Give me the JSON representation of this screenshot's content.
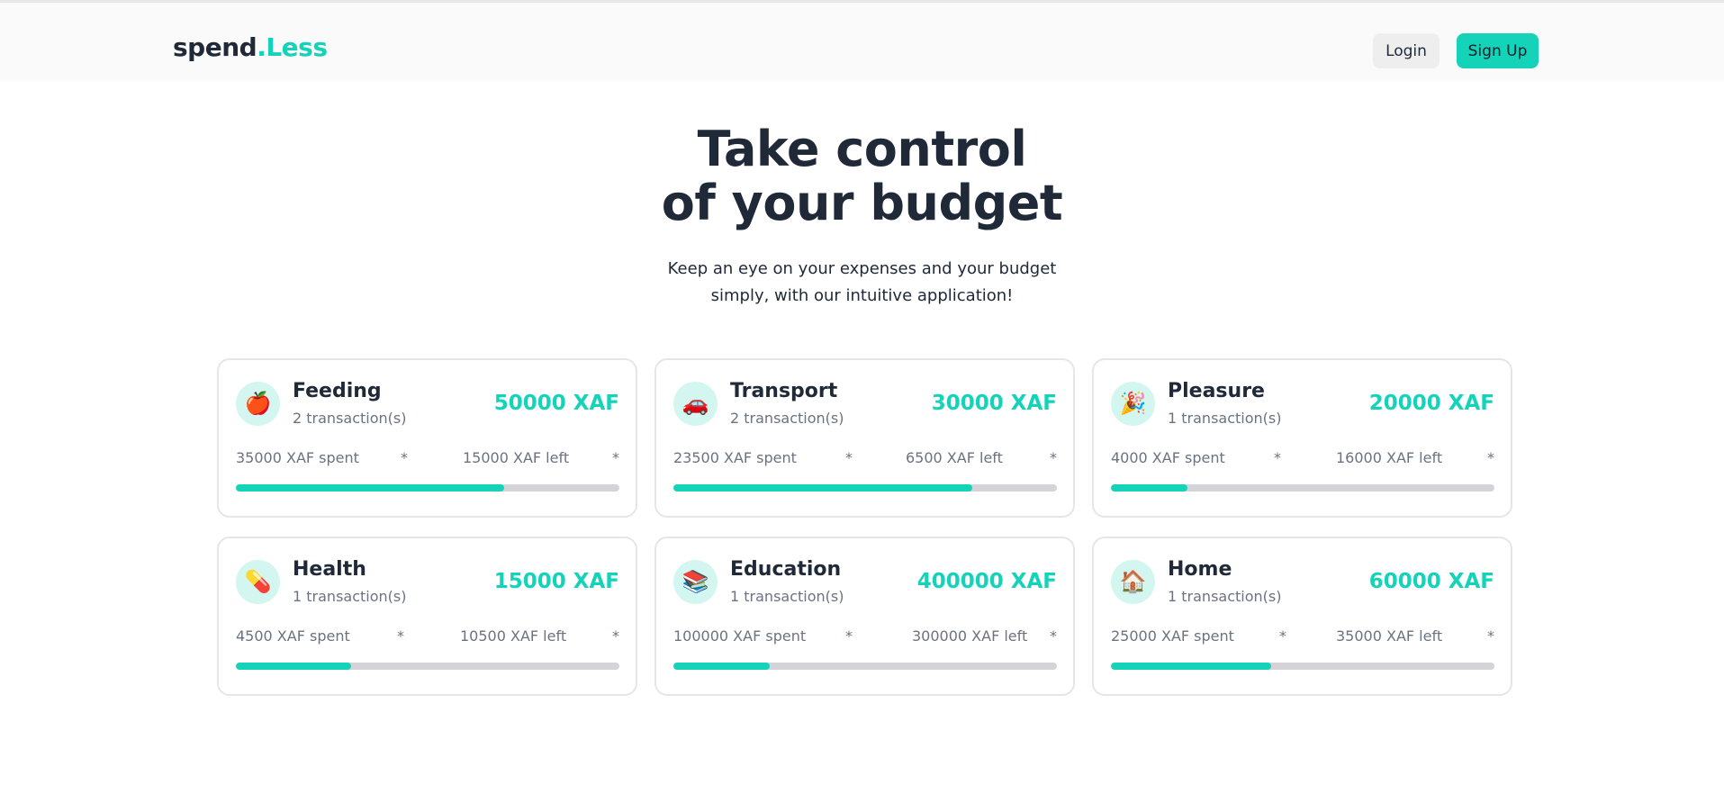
{
  "header": {
    "logo_main": "spend",
    "logo_accent": ".Less",
    "login_label": "Login",
    "signup_label": "Sign Up"
  },
  "hero": {
    "title_line1": "Take control",
    "title_line2": "of your budget",
    "subtitle_line1": "Keep an eye on your expenses and your budget",
    "subtitle_line2": "simply, with our intuitive application!"
  },
  "colors": {
    "accent": "#14d3b9",
    "text": "#1f2937",
    "muted": "#6b7280",
    "track": "#d4d4d8"
  },
  "cards": [
    {
      "name": "Feeding",
      "icon": "apple-icon",
      "emoji": "🍎",
      "transactions": "2 transaction(s)",
      "amount": "50000 XAF",
      "spent": "35000 XAF spent",
      "left": "15000 XAF left",
      "sep1": "*",
      "sep2": "*",
      "progress": 0.7
    },
    {
      "name": "Transport",
      "icon": "car-icon",
      "emoji": "🚗",
      "transactions": "2 transaction(s)",
      "amount": "30000 XAF",
      "spent": "23500 XAF spent",
      "left": "6500 XAF left",
      "sep1": "*",
      "sep2": "*",
      "progress": 0.78
    },
    {
      "name": "Pleasure",
      "icon": "party-popper-icon",
      "emoji": "🎉",
      "transactions": "1 transaction(s)",
      "amount": "20000 XAF",
      "spent": "4000 XAF spent",
      "left": "16000 XAF left",
      "sep1": "*",
      "sep2": "*",
      "progress": 0.2
    },
    {
      "name": "Health",
      "icon": "pill-icon",
      "emoji": "💊",
      "transactions": "1 transaction(s)",
      "amount": "15000 XAF",
      "spent": "4500 XAF spent",
      "left": "10500 XAF left",
      "sep1": "*",
      "sep2": "*",
      "progress": 0.3
    },
    {
      "name": "Education",
      "icon": "books-icon",
      "emoji": "📚",
      "transactions": "1 transaction(s)",
      "amount": "400000 XAF",
      "spent": "100000 XAF spent",
      "left": "300000 XAF left",
      "sep1": "*",
      "sep2": "*",
      "progress": 0.25
    },
    {
      "name": "Home",
      "icon": "house-icon",
      "emoji": "🏠",
      "transactions": "1 transaction(s)",
      "amount": "60000 XAF",
      "spent": "25000 XAF spent",
      "left": "35000 XAF left",
      "sep1": "*",
      "sep2": "*",
      "progress": 0.4167
    }
  ]
}
